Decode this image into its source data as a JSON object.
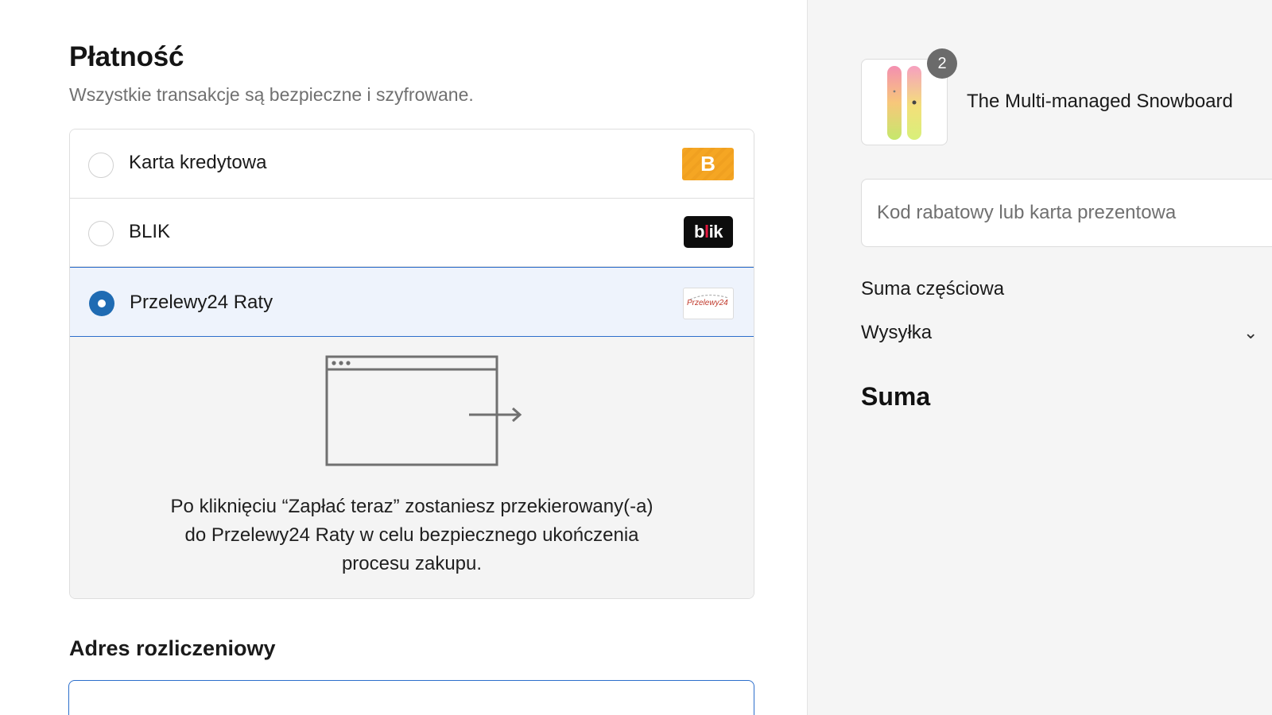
{
  "payment": {
    "title": "Płatność",
    "subtitle": "Wszystkie transakcje są bezpieczne i szyfrowane.",
    "options": [
      {
        "label": "Karta kredytowa",
        "logo": "B",
        "selected": false
      },
      {
        "label": "BLIK",
        "logo": "blik",
        "selected": false
      },
      {
        "label": "Przelewy24 Raty",
        "logo": "Przelewy24",
        "selected": true
      }
    ],
    "redirect_text": "Po kliknięciu “Zapłać teraz” zostaniesz przekierowany(-a) do Przelewy24 Raty w celu bezpiecznego ukończenia procesu zakupu."
  },
  "billing": {
    "title": "Adres rozliczeniowy"
  },
  "summary": {
    "product": {
      "name": "The Multi-managed Snowboard",
      "quantity": "2",
      "icon": "snowboard-thumbnail"
    },
    "discount_placeholder": "Kod rabatowy lub karta prezentowa",
    "subtotal_label": "Suma częściowa",
    "shipping_label": "Wysyłka",
    "total_label": "Suma"
  },
  "colors": {
    "accent": "#1f6bb3",
    "selected_bg": "#eef3fc",
    "selected_border": "#2c6ecb",
    "sidebar_bg": "#f5f5f5"
  }
}
